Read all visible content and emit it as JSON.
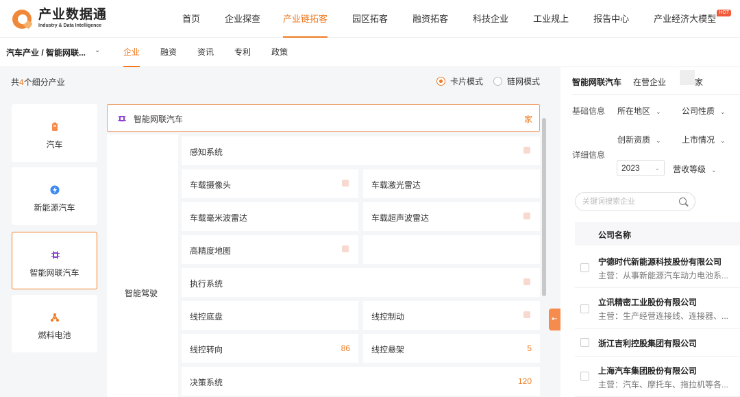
{
  "brand": {
    "title": "产业数据通",
    "subtitle": "Industry & Data Intelligence",
    "color": "#f07a22"
  },
  "nav": {
    "items": [
      {
        "label": "首页",
        "active": false
      },
      {
        "label": "企业探查",
        "active": false
      },
      {
        "label": "产业链拓客",
        "active": true
      },
      {
        "label": "园区拓客",
        "active": false
      },
      {
        "label": "融资拓客",
        "active": false
      },
      {
        "label": "科技企业",
        "active": false
      },
      {
        "label": "工业规上",
        "active": false
      },
      {
        "label": "报告中心",
        "active": false
      },
      {
        "label": "产业经济大模型",
        "active": false,
        "badge": "HOT"
      }
    ]
  },
  "subnav": {
    "breadcrumb": "汽车产业 / 智能网联...",
    "tabs": [
      "企业",
      "融资",
      "资讯",
      "专利",
      "政策"
    ],
    "active_tab": "企业"
  },
  "left": {
    "count_prefix": "共",
    "count": "4",
    "count_suffix": "个细分产业",
    "modes": [
      "卡片模式",
      "链网模式"
    ],
    "selected_mode": "卡片模式",
    "categories": [
      {
        "label": "汽车",
        "icon": "battery-icon",
        "active": false
      },
      {
        "label": "新能源汽车",
        "icon": "ev-icon",
        "active": false
      },
      {
        "label": "智能网联汽车",
        "icon": "chip-icon",
        "active": true
      },
      {
        "label": "燃料电池",
        "icon": "fuel-cell-icon",
        "active": false
      }
    ],
    "chain": {
      "title": "智能网联汽车",
      "unit": "家",
      "segment": "智能驾驶",
      "cells": [
        {
          "label": "感知系统",
          "count": ""
        },
        {
          "label": "车载摄像头",
          "count": ""
        },
        {
          "label": "车载激光雷达",
          "count": ""
        },
        {
          "label": "车载毫米波雷达",
          "count": ""
        },
        {
          "label": "车载超声波雷达",
          "count": ""
        },
        {
          "label": "高精度地图",
          "count": ""
        },
        {
          "label": "执行系统",
          "count": ""
        },
        {
          "label": "线控底盘",
          "count": ""
        },
        {
          "label": "线控制动",
          "count": ""
        },
        {
          "label": "线控转向",
          "count": "86"
        },
        {
          "label": "线控悬架",
          "count": "5"
        },
        {
          "label": "决策系统",
          "count": "120"
        }
      ]
    }
  },
  "right": {
    "title": "智能网联汽车",
    "status": "在营企业",
    "unit": "家",
    "basic_label": "基础信息",
    "detail_label": "详细信息",
    "filters": [
      "所在地区",
      "公司性质",
      "创新资质",
      "上市情况",
      "营收等级"
    ],
    "year": "2023",
    "search_placeholder": "关键词搜索企业",
    "table_header": "公司名称",
    "companies": [
      {
        "name": "宁德时代新能源科技股份有限公司",
        "main": "主营：从事新能源汽车动力电池系..."
      },
      {
        "name": "立讯精密工业股份有限公司",
        "main": "主营：生产经营连接线、连接器、..."
      },
      {
        "name": "浙江吉利控股集团有限公司",
        "main": ""
      },
      {
        "name": "上海汽车集团股份有限公司",
        "main": "主营：汽车、摩托车、拖拉机等各..."
      }
    ]
  }
}
